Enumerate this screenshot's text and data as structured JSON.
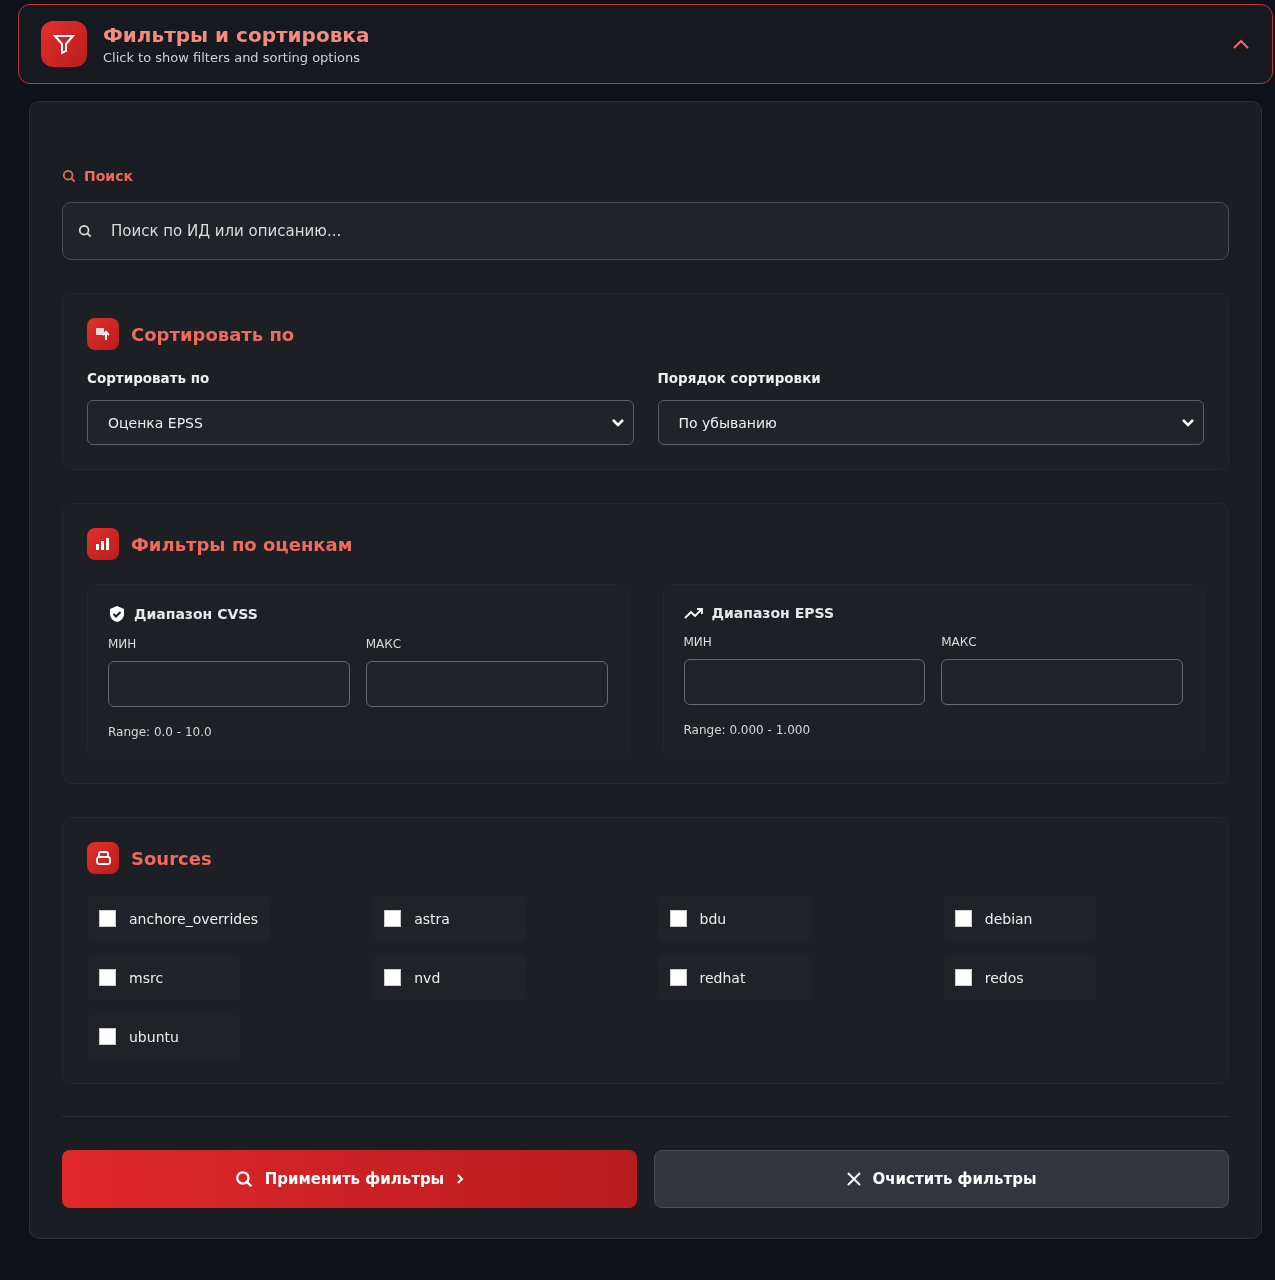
{
  "header": {
    "title": "Фильтры и сортировка",
    "subtitle": "Click to show filters and sorting options",
    "expanded": true
  },
  "search": {
    "label": "Поиск",
    "placeholder": "Поиск по ИД или описанию..."
  },
  "sort": {
    "title": "Сортировать по",
    "fields": [
      {
        "label": "Сортировать по",
        "value": "Оценка EPSS"
      },
      {
        "label": "Порядок сортировки",
        "value": "По убыванию"
      }
    ]
  },
  "scores": {
    "title": "Фильтры по оценкам",
    "ranges": [
      {
        "kind": "shield",
        "title": "Диапазон CVSS",
        "min_label": "МИН",
        "max_label": "МАКС",
        "hint": "Range: 0.0 - 10.0"
      },
      {
        "kind": "trend",
        "title": "Диапазон EPSS",
        "min_label": "МИН",
        "max_label": "МАКС",
        "hint": "Range: 0.000 - 1.000"
      }
    ]
  },
  "sources": {
    "title": "Sources",
    "items": [
      {
        "label": "anchore_overrides",
        "checked": false
      },
      {
        "label": "astra",
        "checked": false
      },
      {
        "label": "bdu",
        "checked": false
      },
      {
        "label": "debian",
        "checked": false
      },
      {
        "label": "msrc",
        "checked": false
      },
      {
        "label": "nvd",
        "checked": false
      },
      {
        "label": "redhat",
        "checked": false
      },
      {
        "label": "redos",
        "checked": false
      },
      {
        "label": "ubuntu",
        "checked": false
      }
    ]
  },
  "buttons": [
    {
      "kind": "apply",
      "label": "Применить фильтры"
    },
    {
      "kind": "clear",
      "label": "Очистить фильтры"
    }
  ]
}
